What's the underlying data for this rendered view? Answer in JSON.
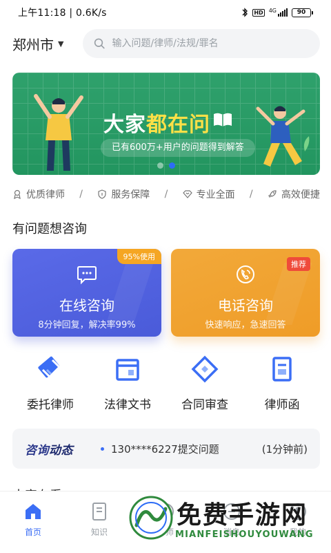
{
  "status_bar": {
    "time_speed": "上午11:18 | 0.6K/s",
    "network": "4G",
    "battery": "90"
  },
  "header": {
    "city": "郑州市",
    "search_placeholder": "输入问题/律师/法规/罪名"
  },
  "banner": {
    "title_part1": "大家",
    "title_part2": "都在问",
    "subtitle": "已有600万+用户的问题得到解答",
    "active_slide": 2,
    "slides": 2
  },
  "features": [
    {
      "label": "优质律师",
      "icon": "person-badge-icon"
    },
    {
      "label": "服务保障",
      "icon": "shield-icon"
    },
    {
      "label": "专业全面",
      "icon": "heart-diamond-icon"
    },
    {
      "label": "高效便捷",
      "icon": "rocket-icon"
    }
  ],
  "section_consult": "有问题想咨询",
  "cards": {
    "online": {
      "title": "在线咨询",
      "subtitle": "8分钟回复，解决率99%",
      "badge": "95%使用",
      "color": "#4f5fe0",
      "icon": "chat-bubble-icon"
    },
    "phone": {
      "title": "电话咨询",
      "subtitle": "快速响应，急速回答",
      "badge": "推荐",
      "color": "#f0a22e",
      "icon": "phone-icon"
    }
  },
  "services": [
    {
      "label": "委托律师",
      "icon": "handshake-icon"
    },
    {
      "label": "法律文书",
      "icon": "folder-doc-icon"
    },
    {
      "label": "合同审查",
      "icon": "contract-diamond-icon"
    },
    {
      "label": "律师函",
      "icon": "letter-icon"
    }
  ],
  "news": {
    "brand_part1": "咨询",
    "brand_part2": "动态",
    "text": "130****6227提交问题",
    "time": "(1分钟前)"
  },
  "more_section": {
    "title": "大家在看",
    "arrow": "›"
  },
  "tabs": [
    {
      "label": "首页",
      "icon": "home-icon",
      "active": true
    },
    {
      "label": "知识",
      "icon": "book-icon",
      "active": false
    },
    {
      "label": "律师",
      "icon": "lawyer-icon",
      "active": false
    },
    {
      "label": "消息",
      "icon": "message-icon",
      "active": false
    },
    {
      "label": "我的",
      "icon": "user-icon",
      "active": false
    }
  ],
  "watermark": {
    "text": "免费手游网",
    "sub": "MIANFEISHOUYOUWANG"
  },
  "colors": {
    "primary": "#3b6ef5",
    "banner_green": "#2a9b66",
    "highlight_yellow": "#fde047"
  }
}
